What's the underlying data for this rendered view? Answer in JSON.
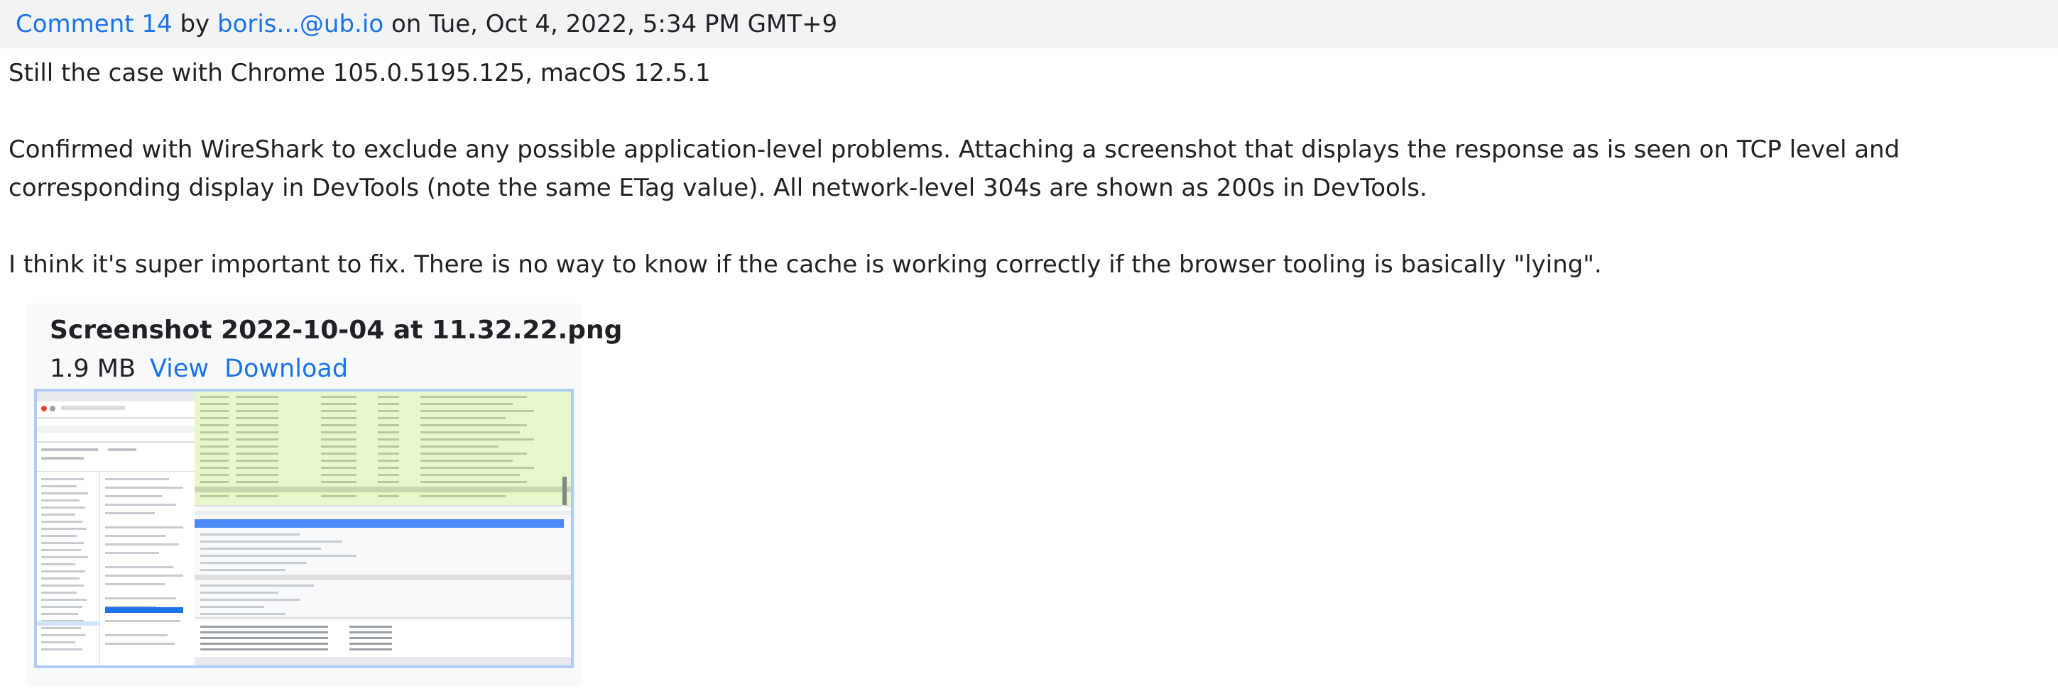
{
  "header": {
    "comment_label": "Comment 14",
    "by": "by",
    "author": "boris...@ub.io",
    "on": "on",
    "date": "Tue, Oct 4, 2022, 5:34 PM GMT+9"
  },
  "body": {
    "paragraph_1": "Still the case with Chrome 105.0.5195.125, macOS 12.5.1",
    "paragraph_2": "Confirmed with WireShark to exclude any possible application-level problems. Attaching a screenshot that displays the response as is seen on TCP level and corresponding display in DevTools (note the same ETag value). All network-level 304s are shown as 200s in DevTools.",
    "paragraph_3": "I think it's super important to fix. There is no way to know if the cache is working correctly if the browser tooling is basically \"lying\"."
  },
  "attachment": {
    "filename": "Screenshot 2022-10-04 at 11.32.22.png",
    "size": "1.9 MB",
    "view_label": "View",
    "download_label": "Download"
  },
  "colors": {
    "link": "#1a73e8",
    "header_bg": "#f1f3f4",
    "thumb_border": "#aecbfa"
  }
}
